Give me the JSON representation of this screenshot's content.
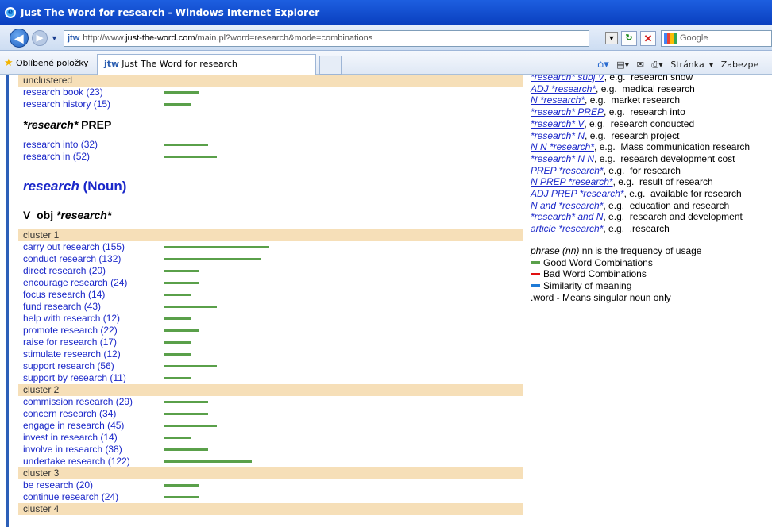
{
  "window": {
    "title": "Just The Word for research - Windows Internet Explorer"
  },
  "nav": {
    "url_prefix": "http://www.",
    "url_host": "just-the-word.com",
    "url_path": "/main.pl?word=research&mode=combinations",
    "search_placeholder": "Google",
    "favicon": "jtw"
  },
  "favbar": {
    "favorites_label": "Oblíbené položky",
    "tab_title": "Just The Word for research",
    "tab_icon": "jtw"
  },
  "cmdbar": {
    "page_label": "Stránka",
    "safety_label": "Zabezpe"
  },
  "left": {
    "unclustered_label": "unclustered",
    "prep_heading_word": "*research*",
    "prep_heading_suffix": "PREP",
    "noun_word": "research",
    "noun_suffix": "(Noun)",
    "vobj_prefix": "V  obj",
    "vobj_word": "*research*",
    "unclustered": [
      {
        "label": "research book (23)",
        "value": 23
      },
      {
        "label": "research history (15)",
        "value": 15
      }
    ],
    "prep": [
      {
        "label": "research into (32)",
        "value": 32
      },
      {
        "label": "research in (52)",
        "value": 52
      }
    ],
    "clusters": [
      {
        "name": "cluster 1",
        "items": [
          {
            "label": "carry out research (155)",
            "value": 155
          },
          {
            "label": "conduct research (132)",
            "value": 132
          },
          {
            "label": "direct research (20)",
            "value": 20
          },
          {
            "label": "encourage research (24)",
            "value": 24
          },
          {
            "label": "focus research (14)",
            "value": 14
          },
          {
            "label": "fund research (43)",
            "value": 43
          },
          {
            "label": "help with research (12)",
            "value": 12
          },
          {
            "label": "promote research (22)",
            "value": 22
          },
          {
            "label": "raise for research (17)",
            "value": 17
          },
          {
            "label": "stimulate research (12)",
            "value": 12
          },
          {
            "label": "support research (56)",
            "value": 56
          },
          {
            "label": "support by research (11)",
            "value": 11
          }
        ]
      },
      {
        "name": "cluster 2",
        "items": [
          {
            "label": "commission research (29)",
            "value": 29
          },
          {
            "label": "concern research (34)",
            "value": 34
          },
          {
            "label": "engage in research (45)",
            "value": 45
          },
          {
            "label": "invest in research (14)",
            "value": 14
          },
          {
            "label": "involve in research (38)",
            "value": 38
          },
          {
            "label": "undertake research (122)",
            "value": 122
          }
        ]
      },
      {
        "name": "cluster 3",
        "items": [
          {
            "label": "be research (20)",
            "value": 20
          },
          {
            "label": "continue research (24)",
            "value": 24
          }
        ]
      },
      {
        "name": "cluster 4",
        "items": []
      }
    ]
  },
  "right": {
    "patterns": [
      {
        "pattern": "*research* subj V",
        "example": ", e.g.  research show"
      },
      {
        "pattern": "ADJ *research*",
        "example": ", e.g.  medical research"
      },
      {
        "pattern": "N *research*",
        "example": ", e.g.  market research"
      },
      {
        "pattern": "*research* PREP",
        "example": ", e.g.  research into"
      },
      {
        "pattern": "*research* V",
        "example": ", e.g.  research conducted"
      },
      {
        "pattern": "*research* N",
        "example": ", e.g.  research project"
      },
      {
        "pattern": "N N *research*",
        "example": ", e.g.  Mass communication research"
      },
      {
        "pattern": "*research* N N",
        "example": ", e.g.  research development cost"
      },
      {
        "pattern": "PREP *research*",
        "example": ", e.g.  for research"
      },
      {
        "pattern": "N PREP *research*",
        "example": ", e.g.  result of research"
      },
      {
        "pattern": "ADJ PREP *research*",
        "example": ", e.g.  available for research"
      },
      {
        "pattern": "N and *research*",
        "example": ", e.g.  education and research"
      },
      {
        "pattern": "*research* and N",
        "example": ", e.g.  research and development"
      },
      {
        "pattern": "article *research*",
        "example": ", e.g.  .research"
      }
    ],
    "legend": {
      "phrase_label": "phrase (nn)",
      "phrase_desc": " nn is the frequency of usage",
      "good": "Good Word Combinations",
      "good_color": "#5aa04a",
      "bad": "Bad Word Combinations",
      "bad_color": "#e01010",
      "similar": "Similarity of meaning",
      "similar_color": "#1e7ad6",
      "singular": ".word - Means singular noun only"
    }
  }
}
